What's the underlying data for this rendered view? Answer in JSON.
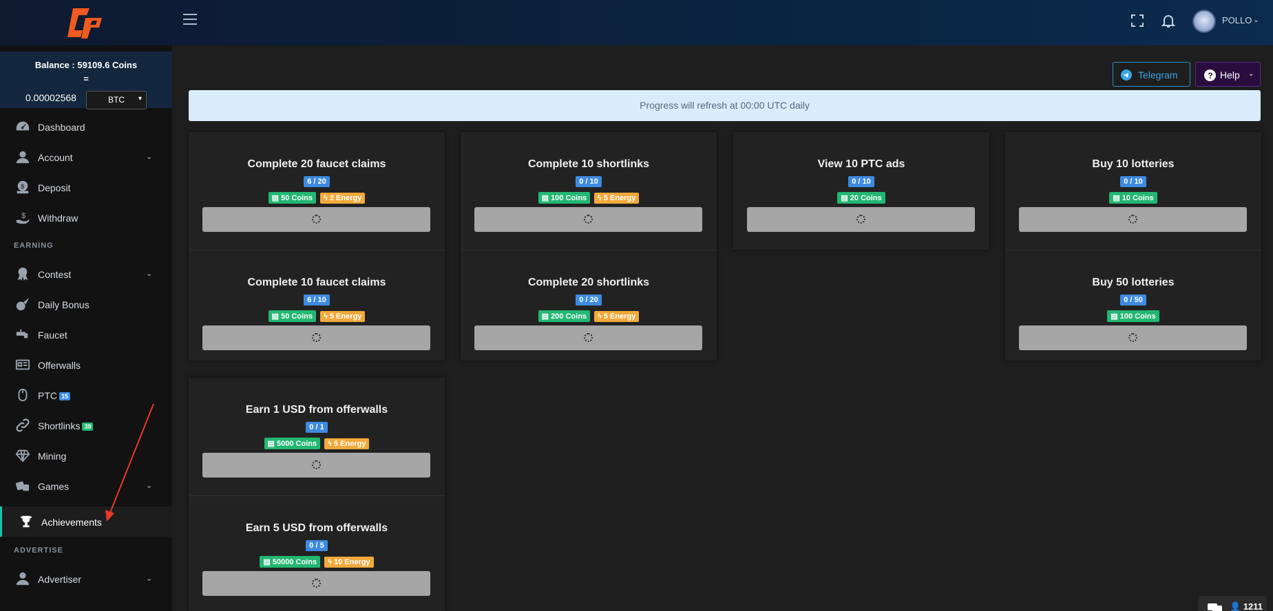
{
  "brand": {
    "logo_text": "CP"
  },
  "header": {
    "user_name": "POLLO",
    "icons": [
      "menu-icon",
      "fullscreen-icon",
      "bell-icon",
      "chevron-down-icon"
    ]
  },
  "balance": {
    "label": "Balance : 59109.6 Coins",
    "equals": "=",
    "btc_value": "0.00002568",
    "currency": "BTC"
  },
  "sidebar": {
    "items": [
      {
        "label": "Dashboard",
        "icon": "dashboard-icon"
      },
      {
        "label": "Account",
        "icon": "user-icon"
      },
      {
        "label": "Deposit",
        "icon": "deposit-icon"
      },
      {
        "label": "Withdraw",
        "icon": "withdraw-icon"
      },
      {
        "label": "Contest",
        "icon": "award-icon"
      },
      {
        "label": "Daily Bonus",
        "icon": "meteor-icon"
      },
      {
        "label": "Faucet",
        "icon": "faucet-icon"
      },
      {
        "label": "Offerwalls",
        "icon": "newspaper-icon"
      },
      {
        "label": "PTC",
        "icon": "mouse-icon",
        "badge": "15"
      },
      {
        "label": "Shortlinks",
        "icon": "link-icon",
        "badge": "39"
      },
      {
        "label": "Mining",
        "icon": "diamond-icon"
      },
      {
        "label": "Games",
        "icon": "dice-icon"
      },
      {
        "label": "Achievements",
        "icon": "trophy-icon"
      },
      {
        "label": "Advertiser",
        "icon": "advertiser-icon"
      }
    ],
    "sections": {
      "earning": "EARNING",
      "advertise": "ADVERTISE"
    }
  },
  "main": {
    "telegram_label": "Telegram",
    "help_label": "Help",
    "alert": "Progress will refresh at 00:00 UTC daily"
  },
  "achievements": [
    {
      "title": "Complete 20 faucet claims",
      "progress": "6 / 20",
      "coins": "50 Coins",
      "energy": "2 Energy"
    },
    {
      "title": "Complete 10 faucet claims",
      "progress": "6 / 10",
      "coins": "50 Coins",
      "energy": "5 Energy"
    },
    {
      "title": "Complete 10 shortlinks",
      "progress": "0 / 10",
      "coins": "100 Coins",
      "energy": "5 Energy"
    },
    {
      "title": "Complete 20 shortlinks",
      "progress": "0 / 20",
      "coins": "200 Coins",
      "energy": "5 Energy"
    },
    {
      "title": "View 10 PTC ads",
      "progress": "0 / 10",
      "coins": "20 Coins"
    },
    {
      "title": "Buy 10 lotteries",
      "progress": "0 / 10",
      "coins": "10 Coins"
    },
    {
      "title": "Buy 50 lotteries",
      "progress": "0 / 50",
      "coins": "100 Coins"
    },
    {
      "title": "Earn 1 USD from offerwalls",
      "progress": "0 / 1",
      "coins": "5000 Coins",
      "energy": "5 Energy"
    },
    {
      "title": "Earn 5 USD from offerwalls",
      "progress": "0 / 5",
      "coins": "50000 Coins",
      "energy": "10 Energy"
    }
  ],
  "chat": {
    "online_count": "1211"
  },
  "colors": {
    "accent": "#17c3b2",
    "brand": "#f25a1f",
    "alert_bg": "#d8ecfb",
    "coins": "#23b772",
    "energy": "#f2a93b",
    "progress": "#3d8be0"
  }
}
